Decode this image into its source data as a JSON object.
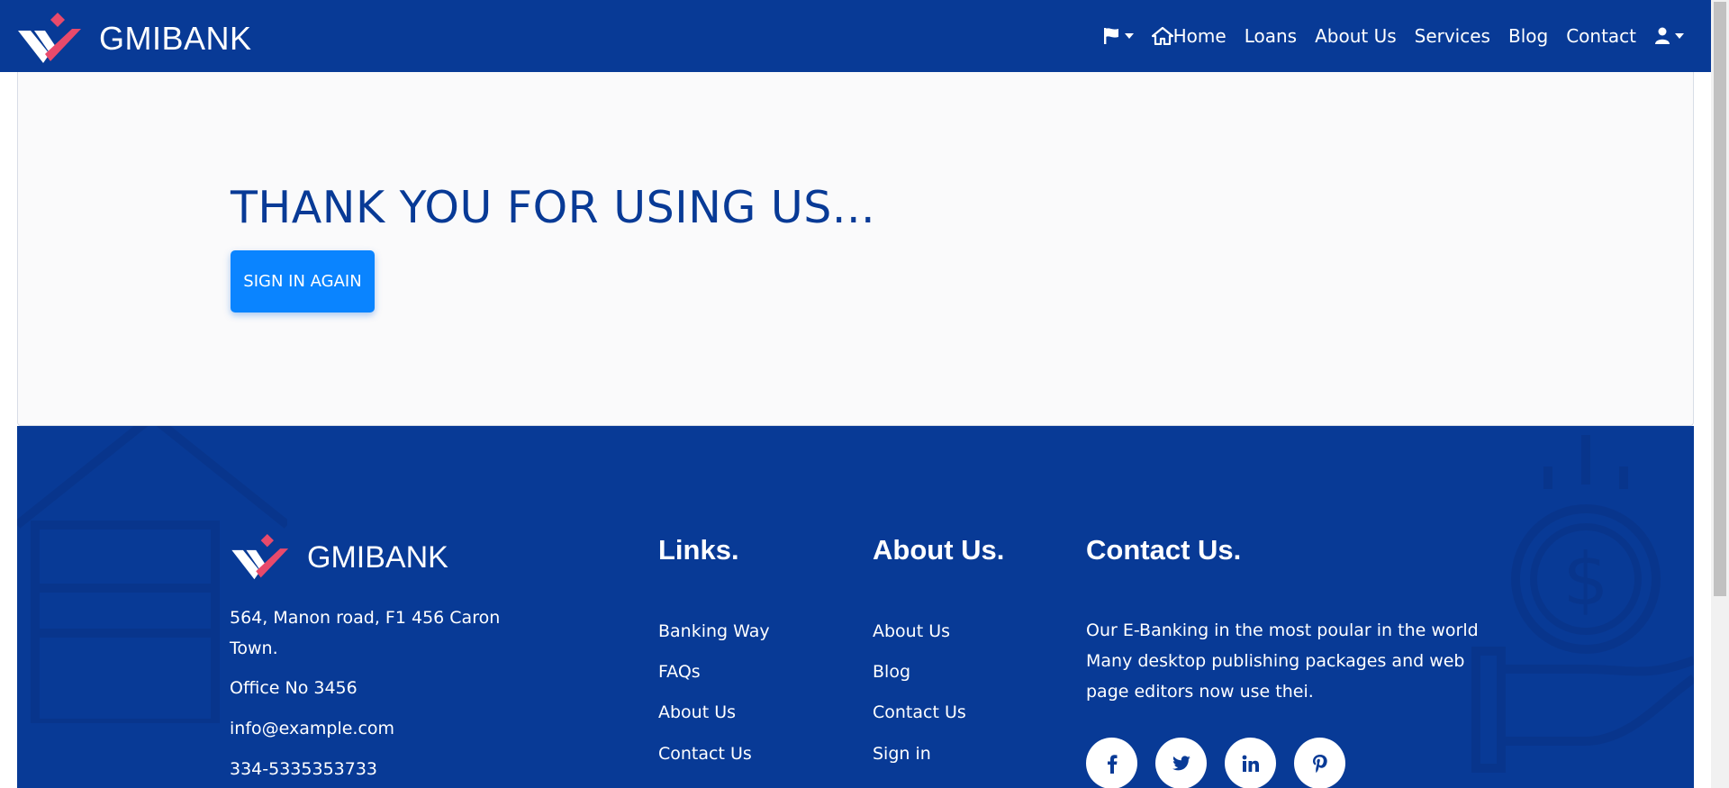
{
  "navbar": {
    "brand": "GMIBANK",
    "items": [
      {
        "label": "Home"
      },
      {
        "label": "Loans"
      },
      {
        "label": "About Us"
      },
      {
        "label": "Services"
      },
      {
        "label": "Blog"
      },
      {
        "label": "Contact"
      }
    ],
    "icons": [
      "flag-icon",
      "home-icon",
      "user-icon"
    ]
  },
  "hero": {
    "title": "THANK YOU FOR USING US...",
    "button": "SIGN IN AGAIN"
  },
  "footer": {
    "brand": "GMIBANK",
    "address_line1": "564, Manon road, F1 456 Caron",
    "address_line2": "Town.",
    "office": "Office No 3456",
    "email": "info@example.com",
    "phone_partial": "334-5335353733",
    "links_heading": "Links.",
    "links": [
      "Banking Way",
      "FAQs",
      "About Us",
      "Contact Us"
    ],
    "about_heading": "About Us.",
    "about_links": [
      "About Us",
      "Blog",
      "Contact Us",
      "Sign in"
    ],
    "contact_heading": "Contact Us.",
    "contact_text": [
      "Our E-Banking in the most poular in the world",
      "Many desktop publishing packages and web",
      "page editors now use thei."
    ],
    "social_icons": [
      "facebook-icon",
      "twitter-icon",
      "linkedin-icon",
      "pinterest-icon"
    ]
  },
  "colors": {
    "primary": "#083a96",
    "button": "#0a84ff",
    "logo_accent": "#e84a6b"
  }
}
